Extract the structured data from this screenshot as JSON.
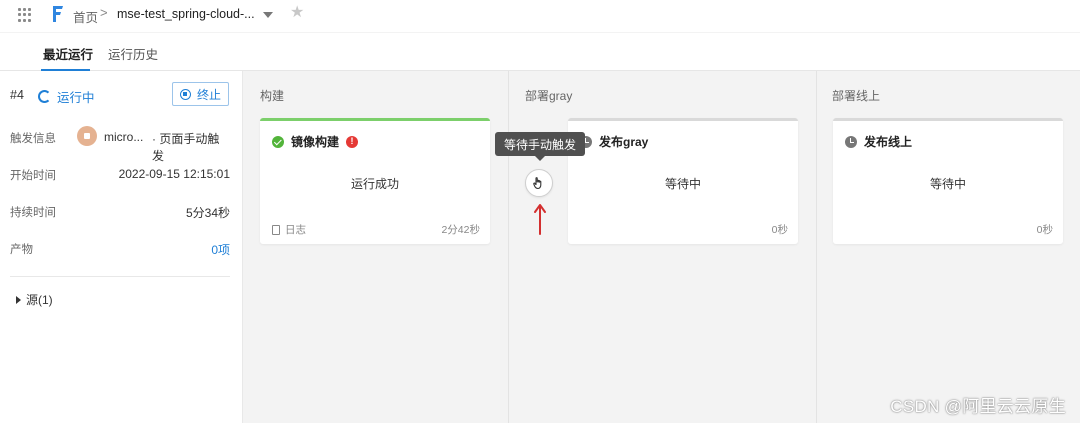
{
  "breadcrumb": {
    "home": "首页",
    "separator": ">",
    "project": "mse-test_spring-cloud-..."
  },
  "icons": {
    "apps": "grid-icon",
    "logo": "flow-logo-icon",
    "dropdown": "chevron-down-icon",
    "favorite": "star-icon"
  },
  "tabs": [
    {
      "label": "最近运行",
      "active": true
    },
    {
      "label": "运行历史",
      "active": false
    }
  ],
  "run": {
    "number": "#4",
    "status": "运行中",
    "stop_label": "终止",
    "info": {
      "trigger_label": "触发信息",
      "trigger_user": "micro...",
      "trigger_method": "· 页面手动触发",
      "start_label": "开始时间",
      "start_value": "2022-09-15 12:15:01",
      "duration_label": "持续时间",
      "duration_value": "5分34秒",
      "artifact_label": "产物",
      "artifact_value": "0项"
    },
    "source": "源(1)"
  },
  "stages": [
    {
      "title": "构建",
      "card": {
        "name": "镜像构建",
        "status": "运行成功",
        "log": "日志",
        "duration": "2分42秒",
        "state": "success"
      }
    },
    {
      "title": "部署gray",
      "card": {
        "name": "发布gray",
        "status": "等待中",
        "log": "",
        "duration": "0秒",
        "state": "waiting"
      }
    },
    {
      "title": "部署线上",
      "card": {
        "name": "发布线上",
        "status": "等待中",
        "log": "",
        "duration": "0秒",
        "state": "waiting"
      }
    }
  ],
  "manual_trigger": {
    "tooltip": "等待手动触发"
  },
  "colors": {
    "accent": "#1f7fd6",
    "success": "#52b43a",
    "error": "#e53935",
    "arrow": "#d32f2f"
  },
  "watermark": "CSDN @阿里云云原生"
}
